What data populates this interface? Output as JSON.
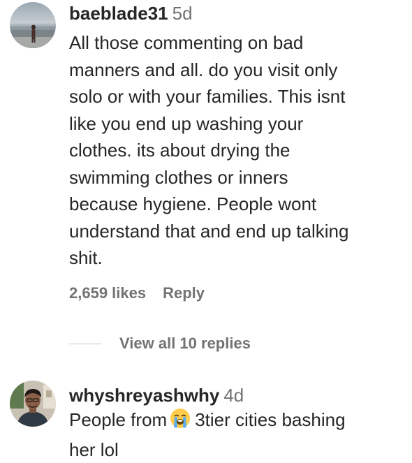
{
  "comments": [
    {
      "username": "baeblade31",
      "age": "5d",
      "lines": [
        "All those commenting on bad",
        "manners and all. do you visit only",
        "solo or with your families. This isnt",
        "like you end up washing your",
        "clothes. its about drying the",
        "swimming clothes or inners",
        "because hygiene. People wont",
        "understand that and end up talking",
        "shit."
      ],
      "likes": "2,659 likes",
      "reply_label": "Reply",
      "view_replies": "View all 10 replies",
      "avatar_icon": "beach-person-avatar"
    },
    {
      "username": "whyshreyashwhy",
      "age": "4d",
      "line1_before": "People from",
      "emoji": "loudly-crying-face-emoji",
      "line1_after": "3tier cities bashing",
      "line2": "her lol",
      "avatar_icon": "person-avatar"
    }
  ],
  "colors": {
    "text": "#262626",
    "secondary": "#737373",
    "divider": "#c7c7c7"
  }
}
